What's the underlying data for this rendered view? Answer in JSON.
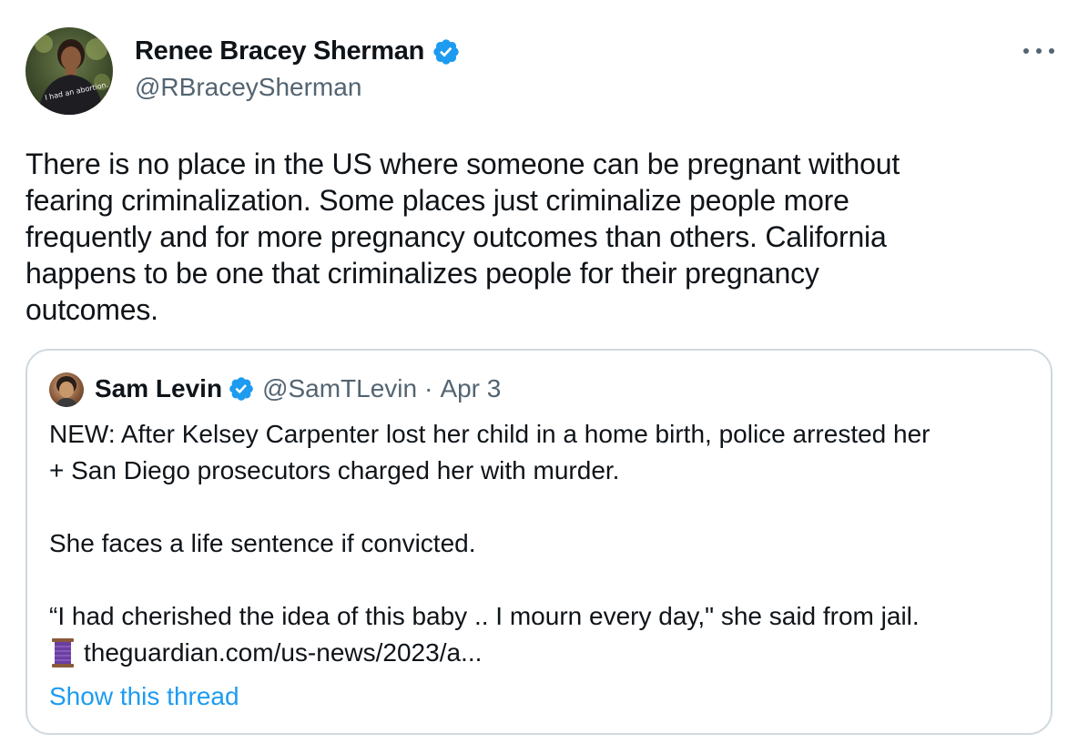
{
  "tweet": {
    "author_name": "Renee Bracey Sherman",
    "author_handle": "@RBraceySherman",
    "avatar_shirt_text": "I had an abortion.",
    "text": "There is no place in the US where someone can be pregnant without\nfearing criminalization. Some places just criminalize people more\nfrequently and for more pregnancy outcomes than others. California\nhappens to be one that criminalizes people for their pregnancy\noutcomes."
  },
  "quote": {
    "author_name": "Sam Levin",
    "author_handle": "@SamTLevin",
    "separator": "·",
    "date": "Apr 3",
    "text": "NEW: After Kelsey Carpenter lost her child in a home birth, police arrested her\n+ San Diego prosecutors charged her with murder.\n\nShe faces a life sentence if convicted.\n\n“I had cherished the idea of this baby .. I mourn every day,\" she said from jail.",
    "link_text": "theguardian.com/us-news/2023/a...",
    "show_thread_label": "Show this thread"
  },
  "icons": {
    "verified": "verified-badge-icon",
    "more": "more-horizontal-icon",
    "thread": "thread-spool-icon"
  },
  "colors": {
    "accent": "#1d9bf0",
    "secondary_text": "#536471",
    "border": "#cfd9de",
    "thread_icon": "#6b3fa0"
  }
}
